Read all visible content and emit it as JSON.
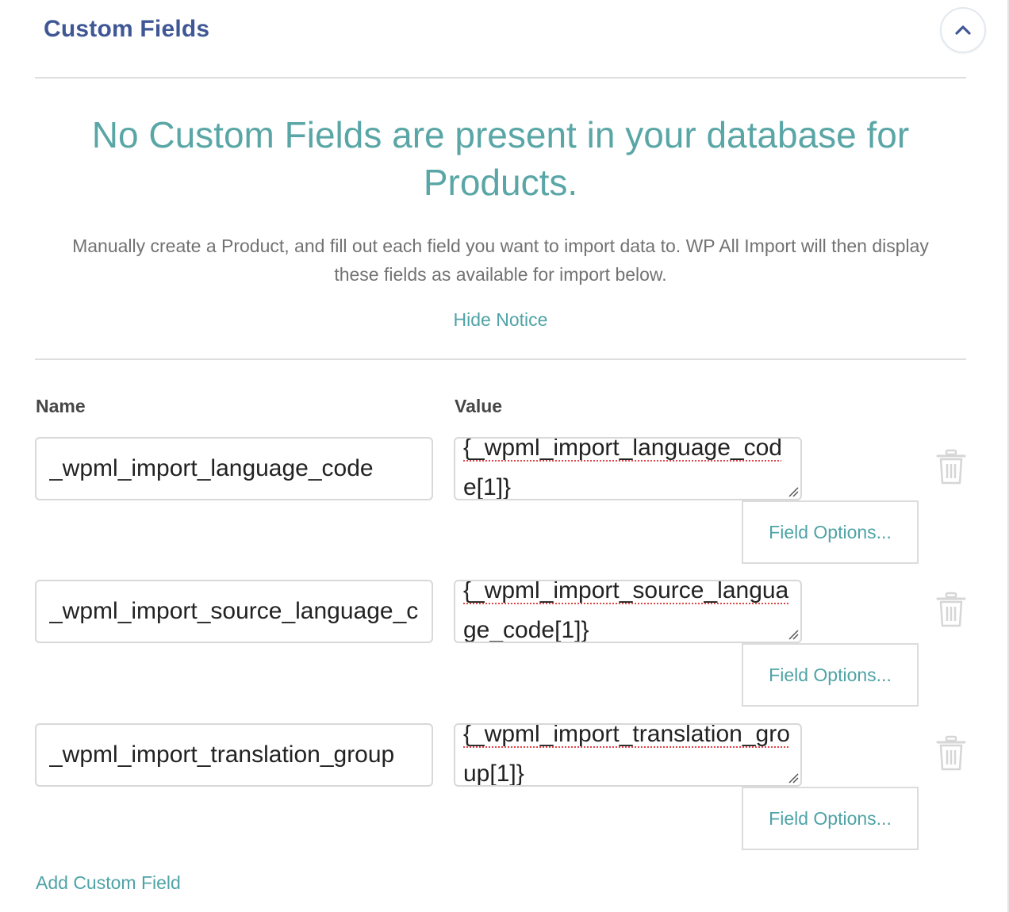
{
  "header": {
    "title": "Custom Fields",
    "collapse_icon": "chevron-up-icon"
  },
  "notice": {
    "heading": "No Custom Fields are present in your database for Products.",
    "body": "Manually create a Product, and fill out each field you want to import data to. WP All Import will then display these fields as available for import below.",
    "hide_link": "Hide Notice"
  },
  "columns": {
    "name": "Name",
    "value": "Value"
  },
  "fields": [
    {
      "name": "_wpml_import_language_code",
      "value": "{_wpml_import_language_code[1]}",
      "options_label": "Field Options...",
      "delete_icon": "trash-icon"
    },
    {
      "name": "_wpml_import_source_language_code",
      "value": "{_wpml_import_source_language_code[1]}",
      "options_label": "Field Options...",
      "delete_icon": "trash-icon"
    },
    {
      "name": "_wpml_import_translation_group",
      "value": "{_wpml_import_translation_group[1]}",
      "options_label": "Field Options...",
      "delete_icon": "trash-icon"
    }
  ],
  "add_field_label": "Add Custom Field",
  "colors": {
    "title": "#3f5795",
    "accent": "#4fa3a6",
    "heading": "#5aa6a6",
    "body_text": "#727272",
    "border": "#d8d8d8"
  }
}
